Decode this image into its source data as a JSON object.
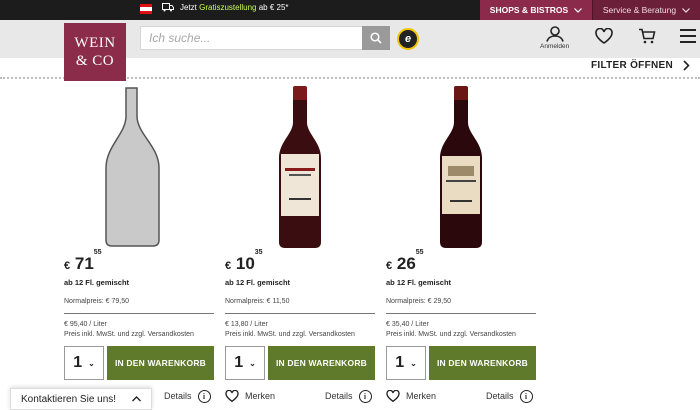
{
  "topbar": {
    "shipping_prefix": "Jetzt",
    "shipping_highlight": "Gratiszustellung",
    "shipping_suffix": "ab € 25*",
    "shops_label": "SHOPS & BISTROS",
    "service_label": "Service & Beratung"
  },
  "header": {
    "logo_line1": "WEIN",
    "logo_line2": "& CO",
    "search_placeholder": "Ich suche...",
    "trusted_badge": "e",
    "login_label": "Anmelden"
  },
  "filter_label": "FILTER ÖFFNEN",
  "products": [
    {
      "price_currency": "€",
      "price_main": "71",
      "price_cents": "55",
      "mixed_label": "ab 12 Fl. gemischt",
      "normal_price": "Normalpreis: € 79,50",
      "per_liter": "€ 95,40 / Liter",
      "tax_note": "Preis inkl. MwSt. und zzgl. Versandkosten",
      "quantity": "1",
      "add_to_cart": "IN DEN WARENKORB",
      "details_label": "Details",
      "bottle": "placeholder"
    },
    {
      "price_currency": "€",
      "price_main": "10",
      "price_cents": "35",
      "mixed_label": "ab 12 Fl. gemischt",
      "normal_price": "Normalpreis: € 11,50",
      "per_liter": "€ 13,80 / Liter",
      "tax_note": "Preis inkl. MwSt. und zzgl. Versandkosten",
      "quantity": "1",
      "add_to_cart": "IN DEN WARENKORB",
      "merken_label": "Merken",
      "details_label": "Details",
      "bottle": "red-wine"
    },
    {
      "price_currency": "€",
      "price_main": "26",
      "price_cents": "55",
      "mixed_label": "ab 12 Fl. gemischt",
      "normal_price": "Normalpreis: € 29,50",
      "per_liter": "€ 35,40 / Liter",
      "tax_note": "Preis inkl. MwSt. und zzgl. Versandkosten",
      "quantity": "1",
      "add_to_cart": "IN DEN WARENKORB",
      "merken_label": "Merken",
      "details_label": "Details",
      "bottle": "red-wine"
    }
  ],
  "contact_label": "Kontaktieren Sie uns!",
  "colors": {
    "brand": "#8a2c4a",
    "cart_button": "#5f7a2a",
    "topbar": "#1c1c1c",
    "header_bg": "#e8e8e8"
  }
}
